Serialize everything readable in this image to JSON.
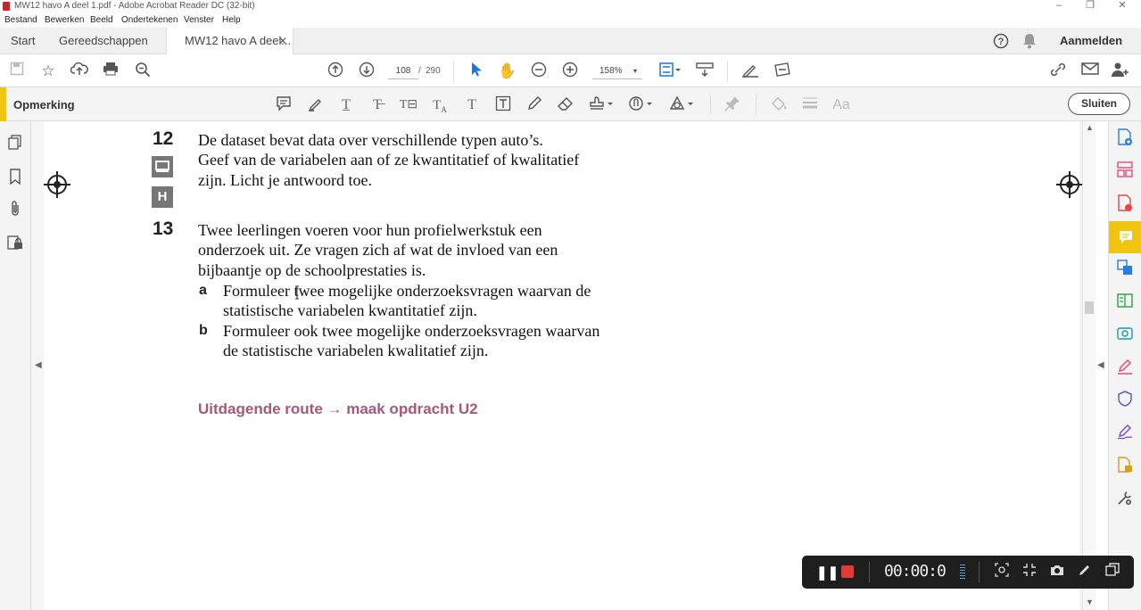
{
  "window": {
    "title": "MW12 havo A deel 1.pdf - Adobe Acrobat Reader DC (32-bit)",
    "controls": [
      "–",
      "❐",
      "✕"
    ]
  },
  "menubar": [
    "Bestand",
    "Bewerken",
    "Beeld",
    "Ondertekenen",
    "Venster",
    "Help"
  ],
  "tabs": {
    "start": "Start",
    "tools": "Gereedschappen",
    "document": "MW12 havo A deel...",
    "close": "✕",
    "signin": "Aanmelden"
  },
  "toolbar": {
    "current_page": "108",
    "separator": "/",
    "total_pages": "290",
    "zoom": "158%"
  },
  "comment_toolbar": {
    "label": "Opmerking",
    "close_label": "Sluiten"
  },
  "document": {
    "q12_number": "12",
    "q12_lines": [
      "De dataset bevat data over verschillende typen auto’s.",
      "Geef van de variabelen aan of ze kwantitatief of kwalitatief",
      "zijn. Licht je antwoord toe."
    ],
    "badge_h": "H",
    "q13_number": "13",
    "q13_lines": [
      "Twee leerlingen voeren voor hun profielwerkstuk een",
      "onderzoek uit. Ze vragen zich af wat de invloed van een",
      "bijbaantje op de schoolprestaties is."
    ],
    "q13a_label": "a",
    "q13a_lines": [
      "Formuleer twee mogelijke onderzoeksvragen waarvan de",
      "statistische variabelen kwantitatief zijn."
    ],
    "q13b_label": "b",
    "q13b_lines": [
      "Formuleer ook twee mogelijke onderzoeksvragen waarvan",
      "de statistische variabelen kwalitatief zijn."
    ],
    "route": "Uitdagende route → maak opdracht U2"
  },
  "recorder": {
    "timer": "00:00:0"
  },
  "colors": {
    "accent_yellow": "#f1c40f",
    "route_pink": "#a8577a",
    "record_red": "#e53935"
  }
}
